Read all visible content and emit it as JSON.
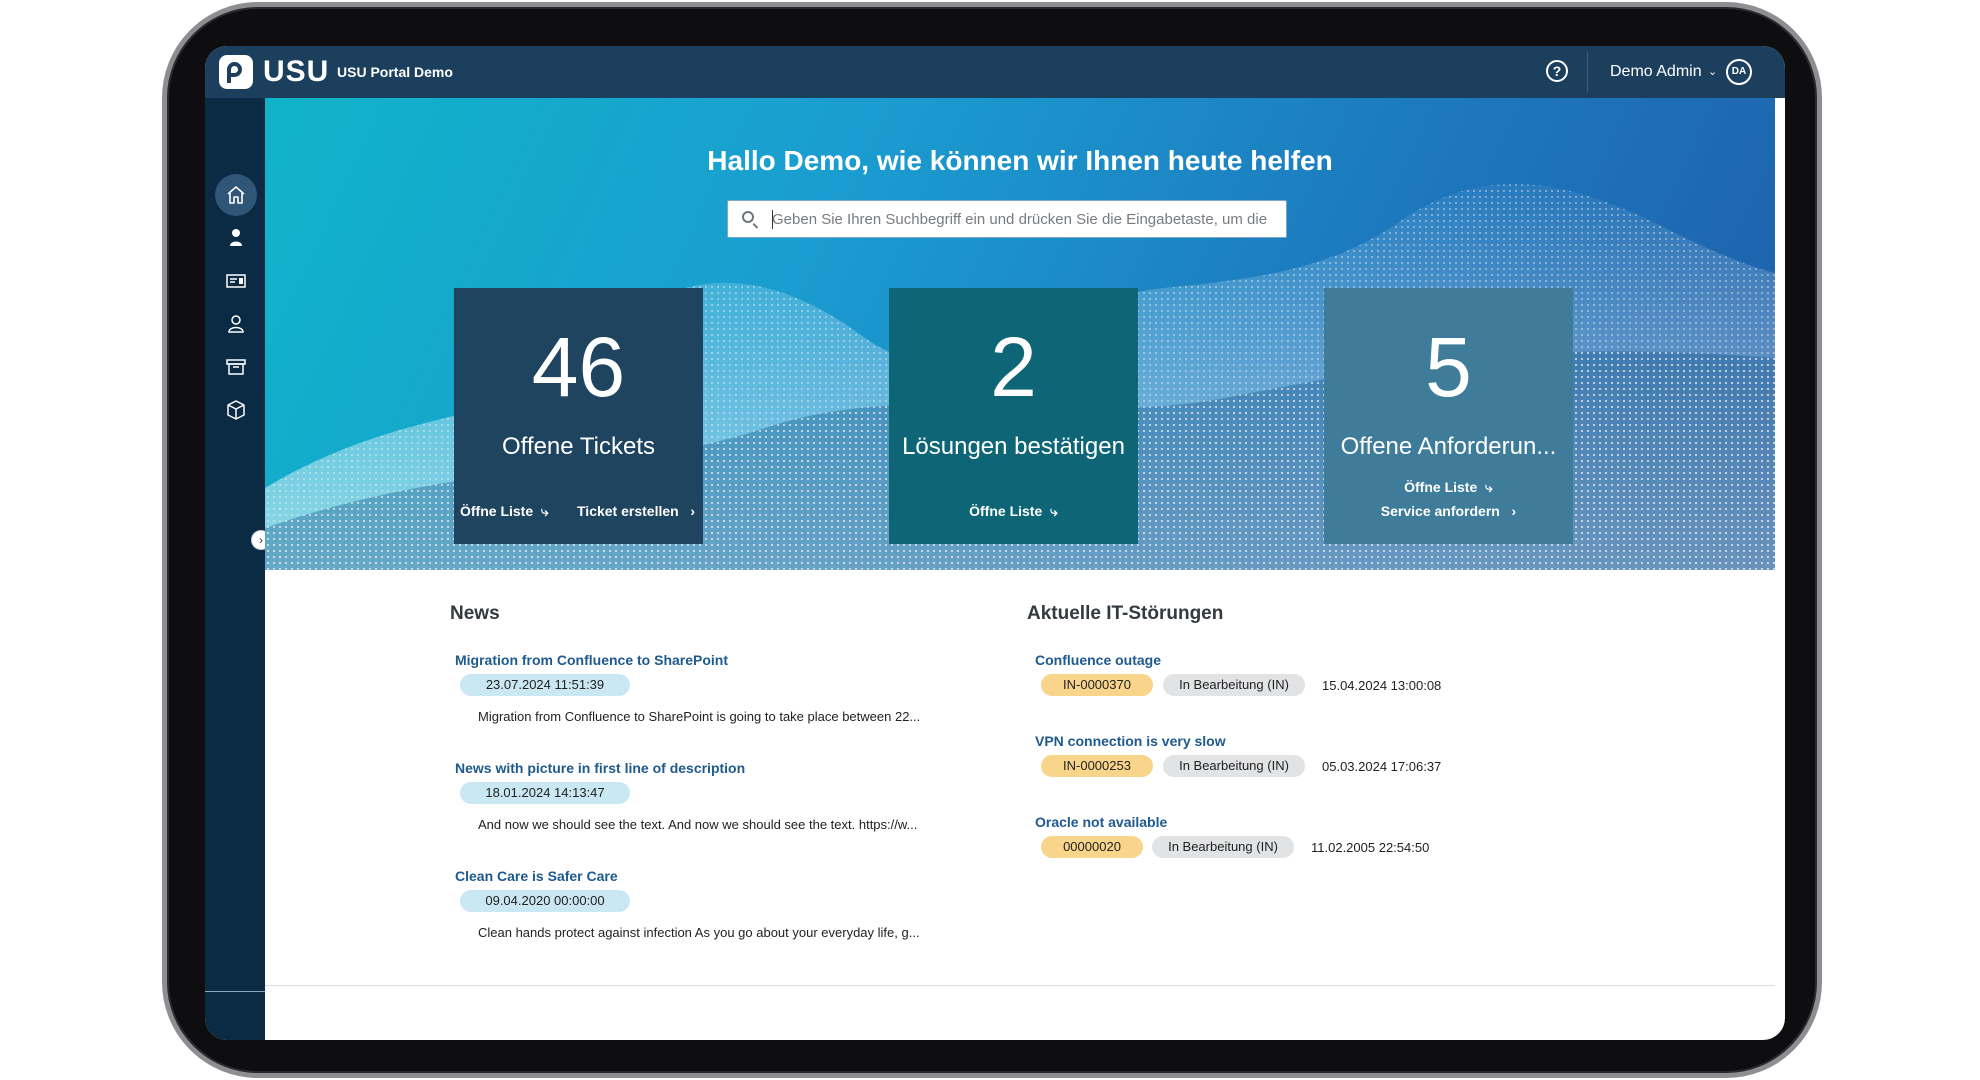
{
  "app": {
    "logo_text": "USU",
    "portal_title": "USU Portal Demo",
    "user_name": "Demo Admin",
    "user_initials": "DA",
    "help_symbol": "?"
  },
  "sidebar": {
    "items": [
      {
        "icon": "home-icon",
        "active": true
      },
      {
        "icon": "person-filled-icon",
        "active": false
      },
      {
        "icon": "ticket-card-icon",
        "active": false
      },
      {
        "icon": "person-outline-icon",
        "active": false
      },
      {
        "icon": "archive-box-icon",
        "active": false
      },
      {
        "icon": "package-cube-icon",
        "active": false
      }
    ],
    "collapse_symbol": "›"
  },
  "hero": {
    "title": "Hallo Demo, wie können wir Ihnen heute helfen",
    "search_placeholder": "Geben Sie Ihren Suchbegriff ein und drücken Sie die Eingabetaste, um die"
  },
  "tiles": [
    {
      "number": "46",
      "label": "Offene Tickets",
      "actions": [
        "Öffne Liste",
        "Ticket erstellen"
      ],
      "color": "#1e4460"
    },
    {
      "number": "2",
      "label": "Lösungen bestätigen",
      "actions": [
        "Öffne Liste"
      ],
      "color": "#0d6576"
    },
    {
      "number": "5",
      "label": "Offene Anforderun...",
      "actions": [
        "Öffne Liste",
        "Service anfordern"
      ],
      "color": "#3e7c9a"
    }
  ],
  "news": {
    "title": "News",
    "items": [
      {
        "title": "Migration from Confluence to SharePoint",
        "date": "23.07.2024 11:51:39",
        "text": "Migration from Confluence to SharePoint is going to take place between 22..."
      },
      {
        "title": "News with picture in first line of description",
        "date": "18.01.2024 14:13:47",
        "text": "And now we should see the text. And now we should see the text. https://w..."
      },
      {
        "title": "Clean Care is Safer Care",
        "date": "09.04.2020 00:00:00",
        "text": "Clean hands protect against infection As you go about your everyday life, g..."
      }
    ]
  },
  "incidents": {
    "title": "Aktuelle IT-Störungen",
    "items": [
      {
        "title": "Confluence outage",
        "id": "IN-0000370",
        "status": "In Bearbeitung (IN)",
        "time": "15.04.2024 13:00:08"
      },
      {
        "title": "VPN connection is very slow",
        "id": "IN-0000253",
        "status": "In Bearbeitung (IN)",
        "time": "05.03.2024 17:06:37"
      },
      {
        "title": "Oracle not available",
        "id": "00000020",
        "status": "In Bearbeitung (IN)",
        "time": "11.02.2005 22:54:50"
      }
    ]
  },
  "colors": {
    "topbar": "#1c3f5e",
    "sidebar": "#0b2a44",
    "link": "#1e5a8e",
    "date_pill": "#c9e8f3",
    "id_pill": "#f8d58a",
    "status_pill": "#e1e3e5"
  }
}
